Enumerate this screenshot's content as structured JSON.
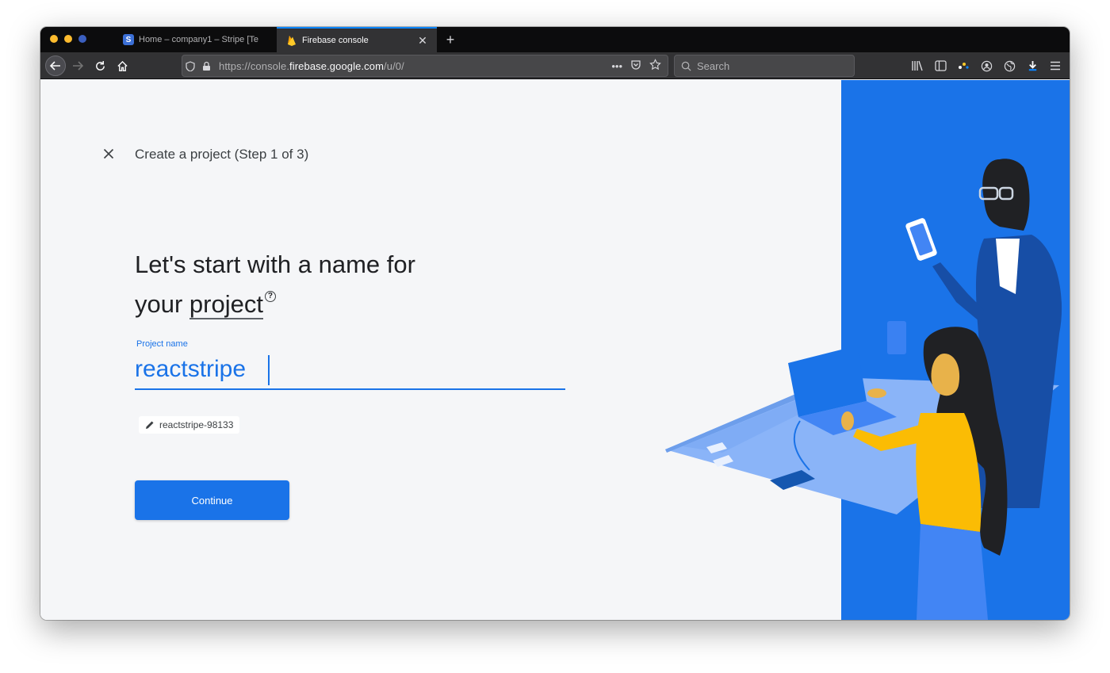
{
  "browser": {
    "tabs": [
      {
        "label": "Home – company1 – Stripe [Te",
        "favicon": "stripe-favicon",
        "active": false
      },
      {
        "label": "Firebase console",
        "favicon": "firebase-favicon",
        "active": true
      }
    ],
    "url": {
      "prefix": "https://console.",
      "domain": "firebase.google.com",
      "path": "/u/0/"
    },
    "search_placeholder": "Search",
    "url_actions": [
      "more-icon",
      "pocket-icon",
      "star-icon"
    ],
    "right_icons": [
      "library-icon",
      "sidebar-icon",
      "extension-icon",
      "account-icon",
      "globe-icon",
      "download-icon",
      "menu-icon"
    ]
  },
  "page": {
    "step_title": "Create a project (Step 1 of 3)",
    "headline_line1": "Let's start with a name for",
    "headline_line2_prefix": "your ",
    "headline_link": "project",
    "help_symbol": "?",
    "field_label": "Project name",
    "field_value": "reactstripe",
    "project_id": "reactstripe-98133",
    "continue_label": "Continue"
  },
  "colors": {
    "primary": "#1a73e8",
    "page_bg": "#f5f6f8",
    "chrome_dark": "#323234"
  }
}
